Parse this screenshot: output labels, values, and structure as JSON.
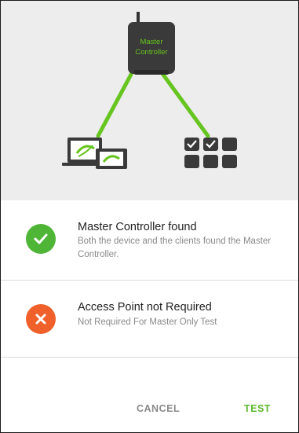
{
  "illustration": {
    "controller_label_line1": "Master",
    "controller_label_line2": "Controller",
    "colors": {
      "accent": "#66c51e",
      "device": "#3a3a3a",
      "background": "#ededed"
    }
  },
  "checks": [
    {
      "status": "success",
      "icon": "checkmark-icon",
      "color": "#4fb536",
      "title": "Master Controller found",
      "description": "Both the device and the clients found the Master Controller."
    },
    {
      "status": "error",
      "icon": "close-icon",
      "color": "#f0602a",
      "title": "Access Point not Required",
      "description": "Not Required For Master Only Test"
    }
  ],
  "actions": {
    "cancel_label": "CANCEL",
    "test_label": "TEST",
    "test_color": "#5cb82c"
  }
}
